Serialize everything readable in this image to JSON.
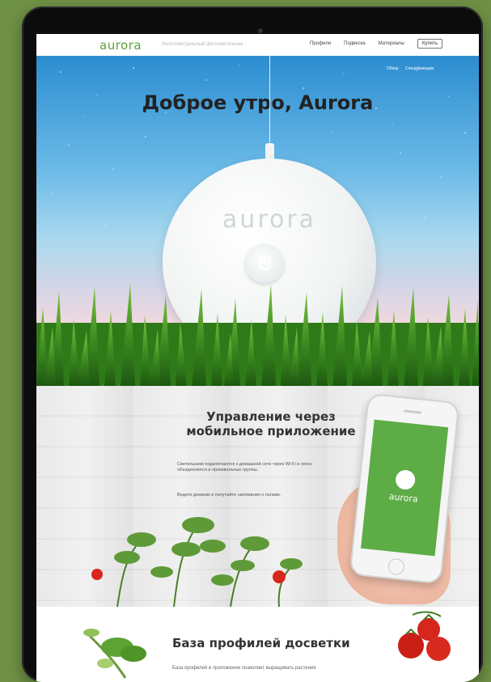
{
  "nav": {
    "logo": "aurora",
    "tagline": "Интеллектуальный фитосветильник",
    "links": [
      "Профили",
      "Подвеска",
      "Материалы"
    ],
    "buy_label": "Купить"
  },
  "hero": {
    "links": [
      "Обзор",
      "Спецификации"
    ],
    "title": "Доброе утро, Aurora",
    "device_brand": "aurora"
  },
  "app_section": {
    "title_line1": "Управление через",
    "title_line2": "мобильное приложение",
    "text1": "Светильники подключаются к домашней сети через Wi-Fi и легко объединяются в произвольные группы.",
    "text2": "Ведите дневник и получайте напоминия о поливе.",
    "phone_logo": "aurora"
  },
  "profile_section": {
    "title": "База профилей досветки",
    "text": "База профилей в приложении позволяет выращивать растения"
  },
  "colors": {
    "background": "#6f9145",
    "brand_green": "#5aa43a",
    "phone_screen": "#5dac45"
  }
}
